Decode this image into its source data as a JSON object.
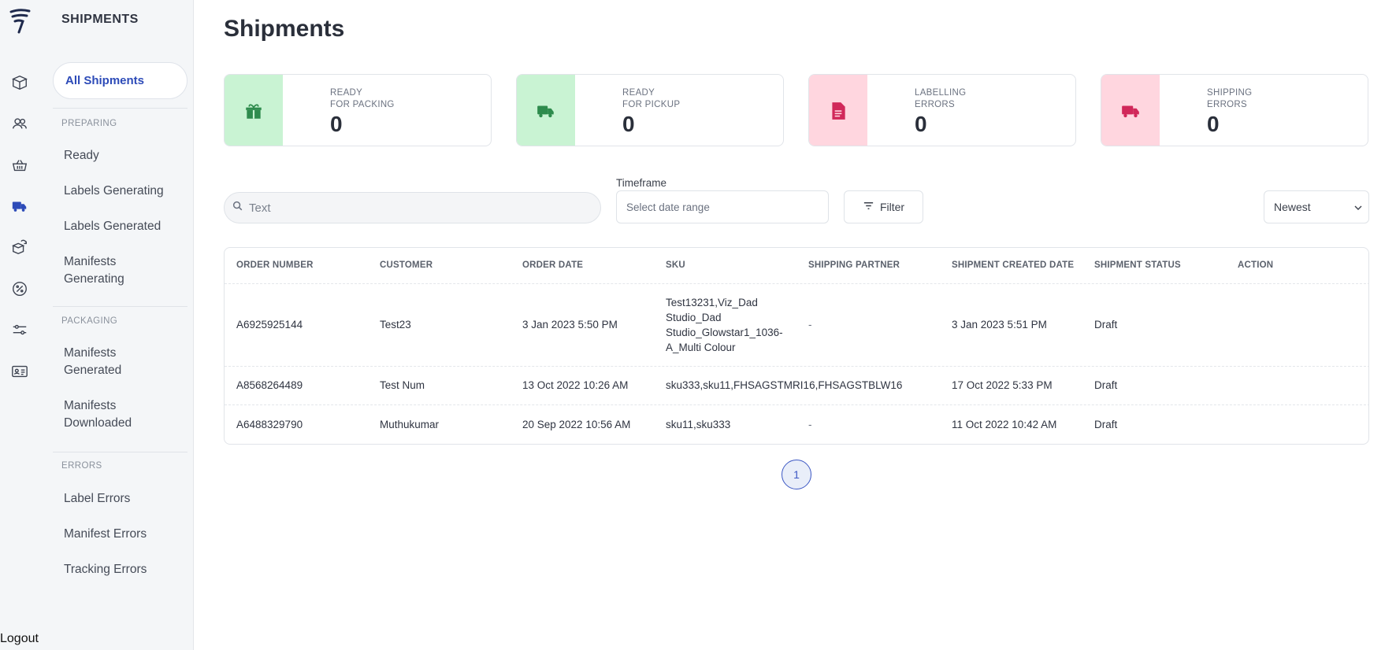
{
  "sidebar": {
    "title": "SHIPMENTS",
    "active": "All Shipments",
    "sections": {
      "preparing": "PREPARING",
      "packaging": "PACKAGING",
      "errors": "ERRORS"
    },
    "items": {
      "ready": "Ready",
      "labels_generating": "Labels Generating",
      "labels_generated": "Labels Generated",
      "manifests_generating": "Manifests Generating",
      "manifests_generated": "Manifests Generated",
      "manifests_downloaded": "Manifests Downloaded",
      "label_errors": "Label Errors",
      "manifest_errors": "Manifest Errors",
      "tracking_errors": "Tracking Errors"
    },
    "logout": "Logout"
  },
  "rail_icons": [
    "logo-icon",
    "box-icon",
    "users-icon",
    "basket-icon",
    "truck-icon",
    "returns-icon",
    "discount-icon",
    "sliders-icon",
    "id-card-icon"
  ],
  "page": {
    "title": "Shipments"
  },
  "cards": [
    {
      "label_line1": "READY",
      "label_line2": "FOR PACKING",
      "value": "0",
      "icon": "package-icon",
      "tone": "green"
    },
    {
      "label_line1": "READY",
      "label_line2": "FOR PICKUP",
      "value": "0",
      "icon": "truck-icon",
      "tone": "green"
    },
    {
      "label_line1": "LABELLING",
      "label_line2": "ERRORS",
      "value": "0",
      "icon": "document-icon",
      "tone": "pink"
    },
    {
      "label_line1": "SHIPPING",
      "label_line2": "ERRORS",
      "value": "0",
      "icon": "truck-icon",
      "tone": "pink"
    }
  ],
  "search": {
    "placeholder": "Text",
    "value": ""
  },
  "timeframe": {
    "label": "Timeframe",
    "placeholder": "Select date range"
  },
  "filter": {
    "label": "Filter"
  },
  "sort": {
    "value": "Newest"
  },
  "table": {
    "headers": {
      "order_number": "ORDER NUMBER",
      "customer": "CUSTOMER",
      "order_date": "ORDER DATE",
      "sku": "SKU",
      "shipping_partner": "SHIPPING PARTNER",
      "shipment_created_date": "SHIPMENT CREATED DATE",
      "shipment_status": "SHIPMENT STATUS",
      "action": "ACTION"
    },
    "rows": [
      {
        "order_number": "A6925925144",
        "customer": "Test23",
        "order_date": "3 Jan 2023 5:50 PM",
        "sku_lines": [
          "Test13231,Viz_Dad",
          "Studio_Dad",
          "Studio_Glowstar1_1036-",
          "A_Multi Colour"
        ],
        "shipping_partner": "-",
        "shipment_created_date": "3 Jan 2023 5:51 PM",
        "shipment_status": "Draft"
      },
      {
        "order_number": "A8568264489",
        "customer": "Test Num",
        "order_date": "13 Oct 2022 10:26 AM",
        "sku": "sku333,sku11,FHSAGSTMRI16,FHSAGSTBLW16",
        "shipping_partner": "",
        "shipment_created_date": "17 Oct 2022 5:33 PM",
        "shipment_status": "Draft"
      },
      {
        "order_number": "A6488329790",
        "customer": "Muthukumar",
        "order_date": "20 Sep 2022 10:56 AM",
        "sku": "sku11,sku333",
        "shipping_partner": "-",
        "shipment_created_date": "11 Oct 2022 10:42 AM",
        "shipment_status": "Draft"
      }
    ]
  },
  "pagination": {
    "current": "1"
  },
  "colors": {
    "accent": "#2d4bb8",
    "success_bg": "#c9f3d3",
    "success_fg": "#2e8b4d",
    "error_bg": "#ffd6df",
    "error_fg": "#d1285a"
  }
}
